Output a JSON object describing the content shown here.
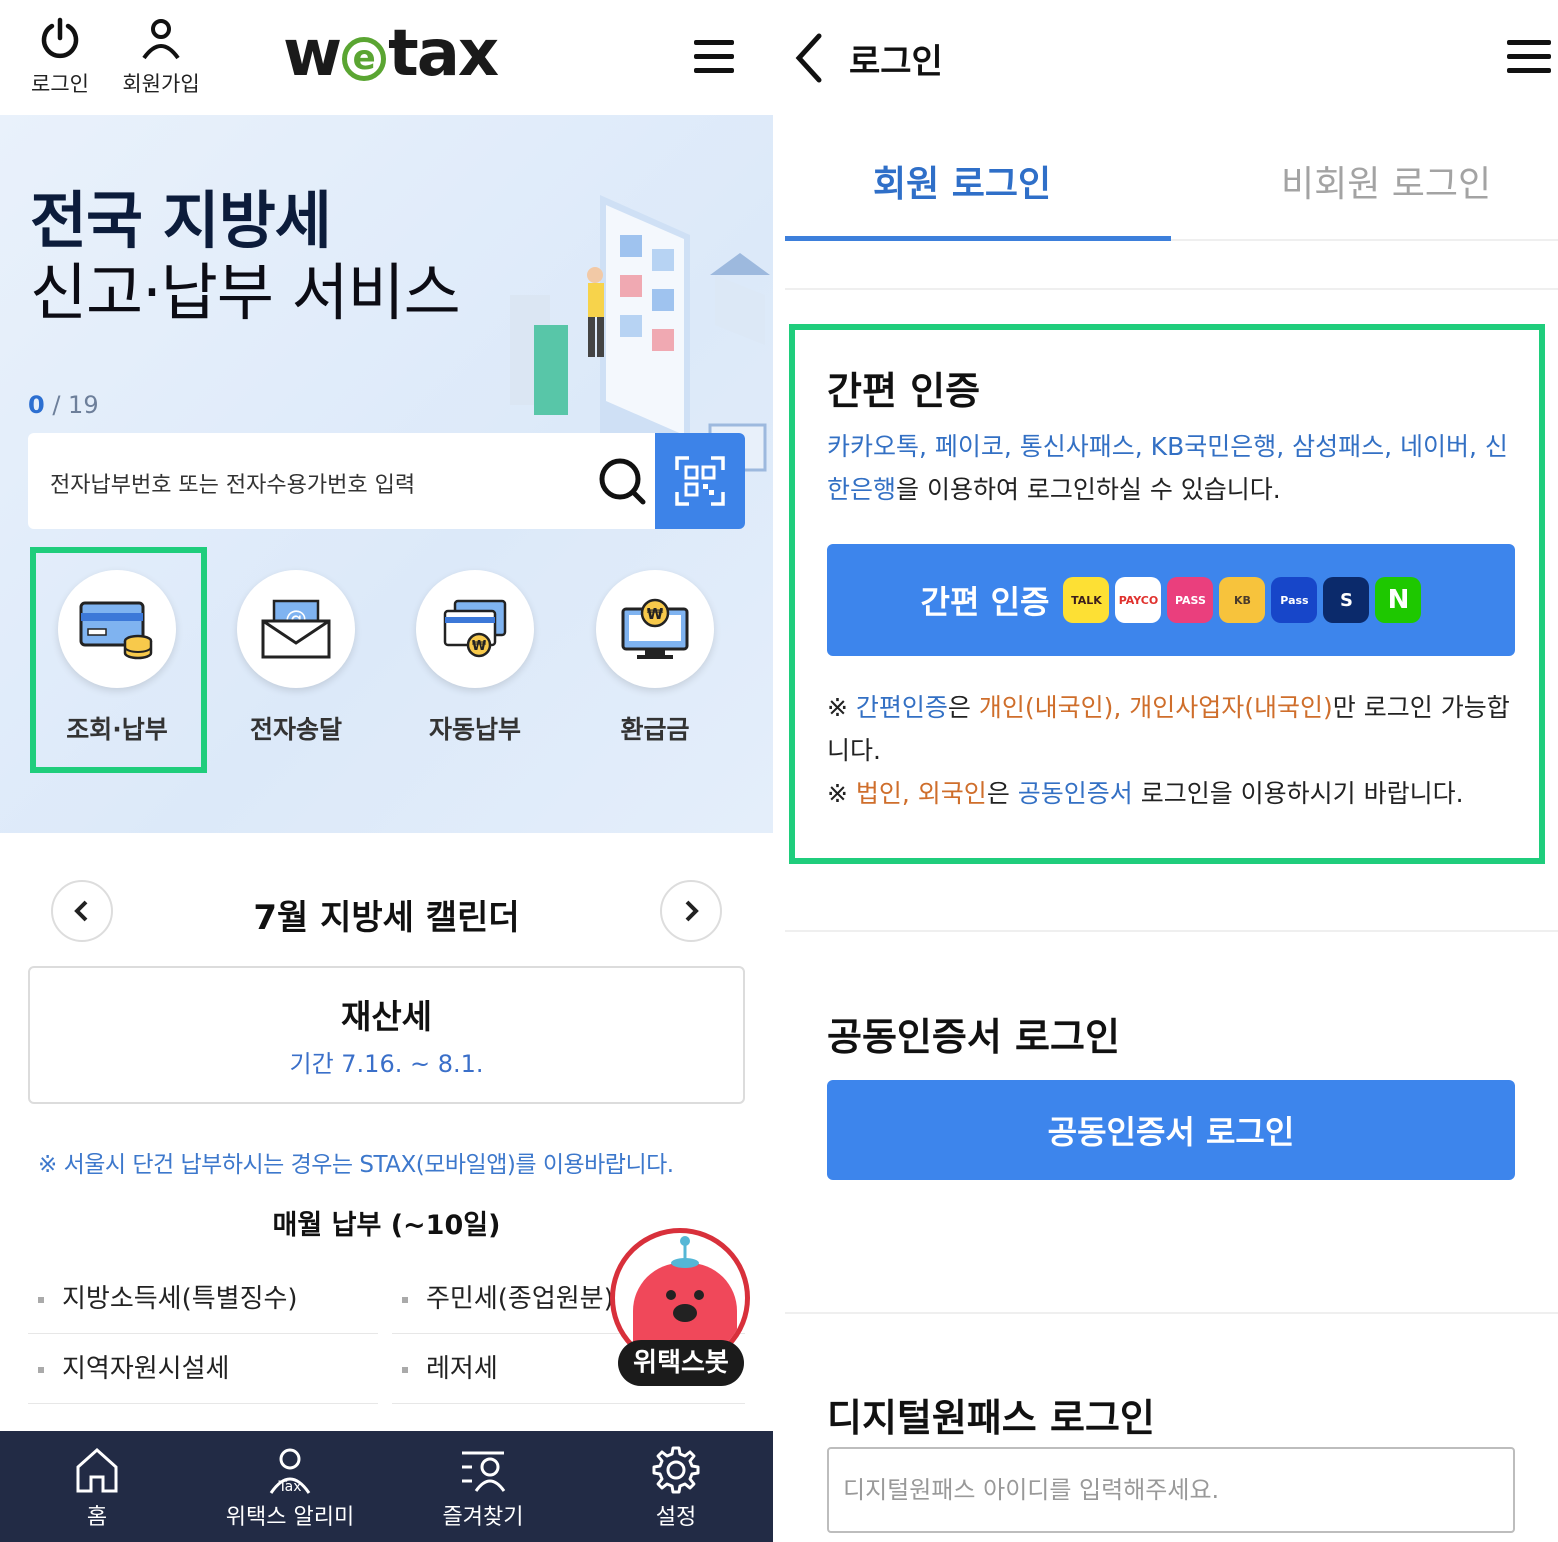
{
  "left": {
    "header": {
      "login": "로그인",
      "signup": "회원가입",
      "logo_pre": "w",
      "logo_e": "e",
      "logo_post": "tax"
    },
    "hero": {
      "title_line1": "전국 지방세",
      "title_line2": "신고·납부 서비스",
      "counter_current": "0",
      "counter_total": " / 19"
    },
    "search": {
      "placeholder": "전자납부번호 또는 전자수용가번호 입력"
    },
    "quick_menu": [
      {
        "label": "조회·납부",
        "icon": "card-coins-icon"
      },
      {
        "label": "전자송달",
        "icon": "email-envelope-icon"
      },
      {
        "label": "자동납부",
        "icon": "auto-payment-icon"
      },
      {
        "label": "환급금",
        "icon": "refund-monitor-icon"
      }
    ],
    "calendar": {
      "title": "7월 지방세 캘린더",
      "tax_name": "재산세",
      "tax_period": "기간 7.16. ~ 8.1.",
      "notice": "※ 서울시 단건 납부하시는 경우는 STAX(모바일앱)를 이용바랍니다.",
      "monthly_title": "매월 납부 (~10일)",
      "monthly_items": [
        "지방소득세(특별징수)",
        "주민세(종업원분)",
        "지역자원시설세",
        "레저세"
      ]
    },
    "chatbot": {
      "label": "위택스봇"
    },
    "bottom_nav": [
      {
        "label": "홈",
        "icon": "home-icon"
      },
      {
        "label": "위택스 알리미",
        "icon": "tax-alarm-icon"
      },
      {
        "label": "즐겨찾기",
        "icon": "favorites-icon"
      },
      {
        "label": "설정",
        "icon": "gear-icon"
      }
    ]
  },
  "right": {
    "header": {
      "title": "로그인"
    },
    "tabs": [
      {
        "label": "회원 로그인",
        "active": true
      },
      {
        "label": "비회원 로그인",
        "active": false
      }
    ],
    "simple_auth": {
      "title": "간편 인증",
      "providers_text": "카카오톡, 페이코, 통신사패스, KB국민은행, 삼성패스, 네이버, 신한은행",
      "desc_suffix": "을 이용하여 로그인하실 수 있습니다.",
      "button_label": "간편 인증",
      "badges": [
        "TALK",
        "PAYCO",
        "PASS",
        "KB",
        "Pass",
        "S",
        "N"
      ],
      "note1_prefix": "※ ",
      "note1_a": "간편인증",
      "note1_b": "은 ",
      "note1_c": "개인(내국인), 개인사업자(내국인)",
      "note1_d": "만 로그인 가능합니다.",
      "note2_prefix": "※ ",
      "note2_a": "법인, 외국인",
      "note2_b": "은 ",
      "note2_c": "공동인증서",
      "note2_d": " 로그인을 이용하시기 바랍니다."
    },
    "cert_login": {
      "title": "공동인증서 로그인",
      "button_label": "공동인증서 로그인"
    },
    "digital_login": {
      "title": "디지털원패스 로그인",
      "placeholder": "디지털원패스 아이디를 입력해주세요."
    }
  },
  "colors": {
    "accent_blue": "#3d85ec",
    "highlight_green": "#1fcd7c",
    "nav_bg": "#222b45",
    "link_blue": "#3370c4",
    "orange": "#cf6e2b"
  }
}
